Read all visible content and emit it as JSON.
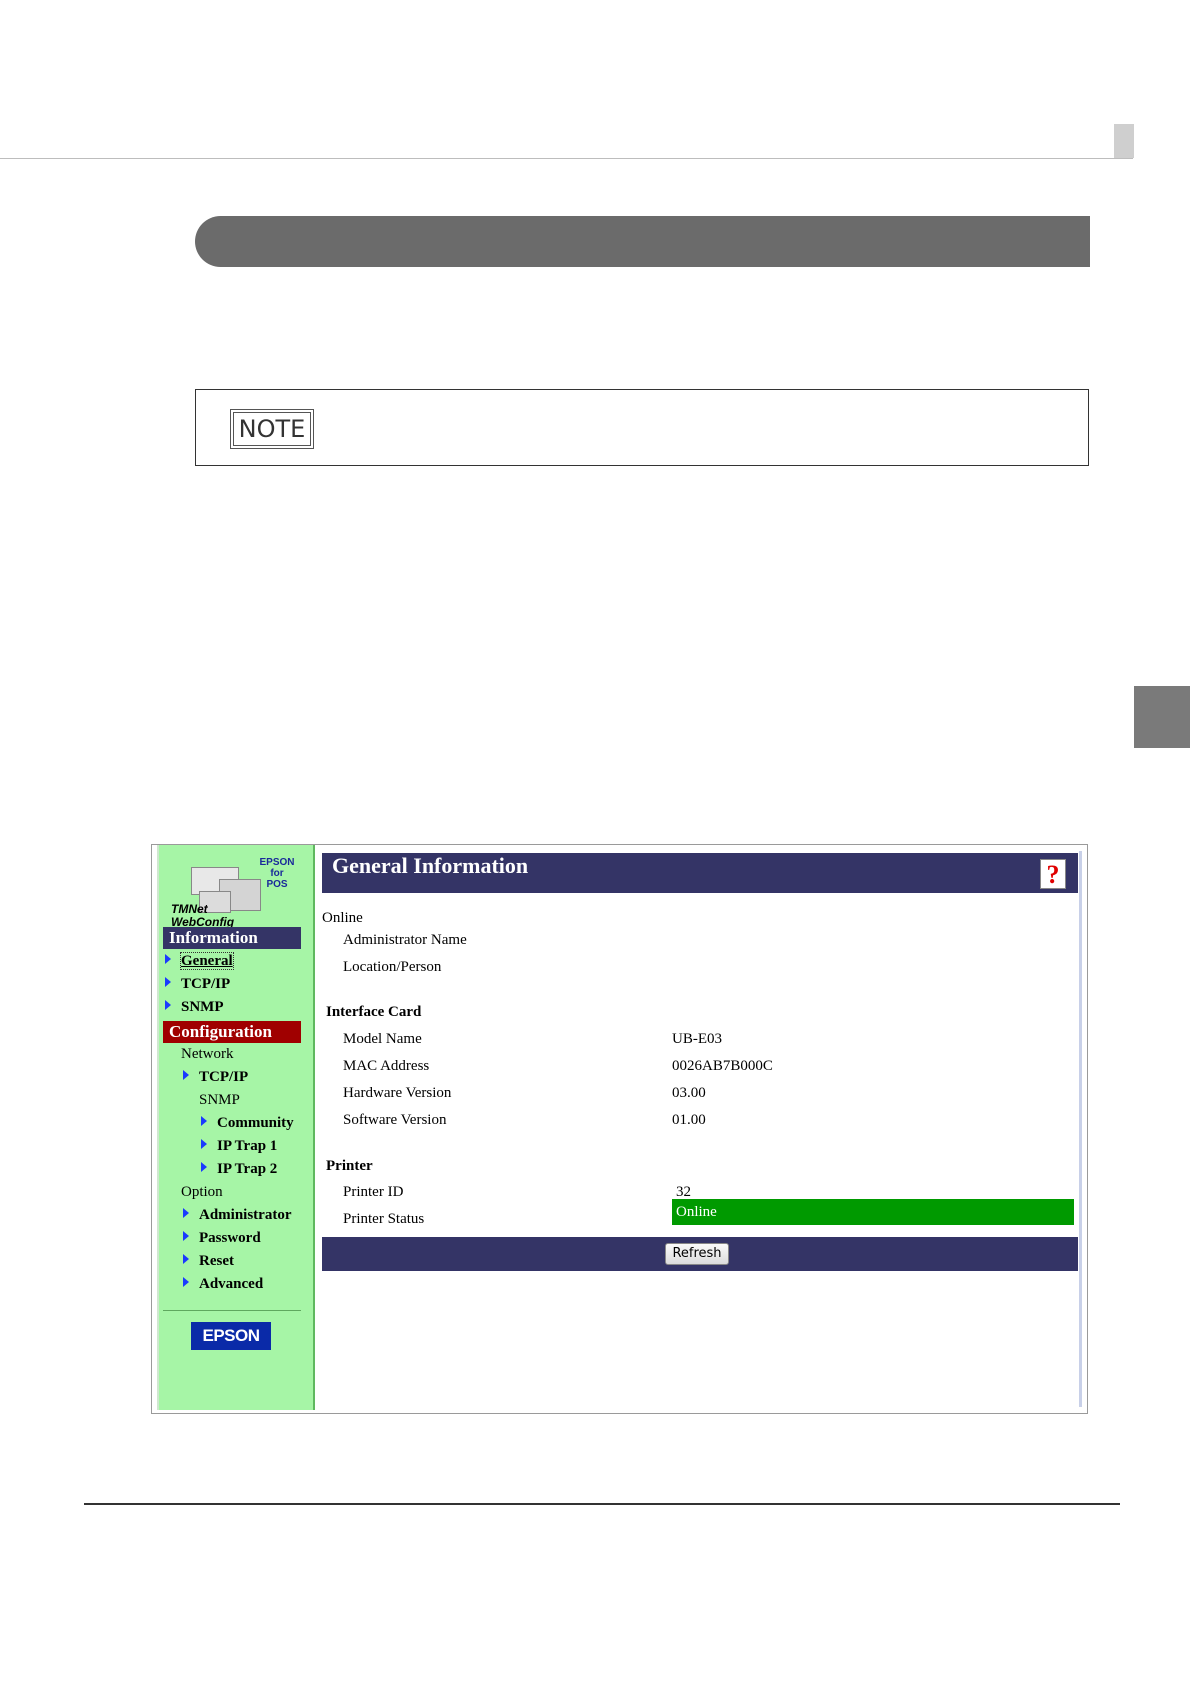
{
  "note_badge": "NOTE",
  "logo": {
    "epson": "EPSON",
    "for": "for",
    "pos": "POS",
    "tmnet": "TMNet",
    "webconfig": "WebConfig"
  },
  "sidebar": {
    "information_header": "Information",
    "info_items": [
      "General",
      "TCP/IP",
      "SNMP"
    ],
    "configuration_header": "Configuration",
    "network_label": "Network",
    "network_tcpip": "TCP/IP",
    "snmp_label": "SNMP",
    "snmp_items": [
      "Community",
      "IP Trap 1",
      "IP Trap 2"
    ],
    "option_label": "Option",
    "option_items": [
      "Administrator",
      "Password",
      "Reset",
      "Advanced"
    ],
    "brand_button": "EPSON"
  },
  "main": {
    "title": "General Information",
    "help_icon": "?",
    "online_section": "Online",
    "online_fields": [
      {
        "label": "Administrator Name",
        "value": ""
      },
      {
        "label": "Location/Person",
        "value": ""
      }
    ],
    "interface_section": "Interface Card",
    "interface_fields": [
      {
        "label": "Model Name",
        "value": "UB-E03"
      },
      {
        "label": "MAC Address",
        "value": "0026AB7B000C"
      },
      {
        "label": "Hardware Version",
        "value": "03.00"
      },
      {
        "label": "Software Version",
        "value": "01.00"
      }
    ],
    "printer_section": "Printer",
    "printer_fields": [
      {
        "label": "Printer ID",
        "value": "32"
      },
      {
        "label": "Printer Status",
        "value": "Online"
      }
    ],
    "refresh_button": "Refresh"
  },
  "colors": {
    "sidebar_bg": "#a6f5a6",
    "header_navy": "#343466",
    "config_red": "#a00000",
    "status_green": "#009a00",
    "link_arrow": "#1a3aff"
  }
}
